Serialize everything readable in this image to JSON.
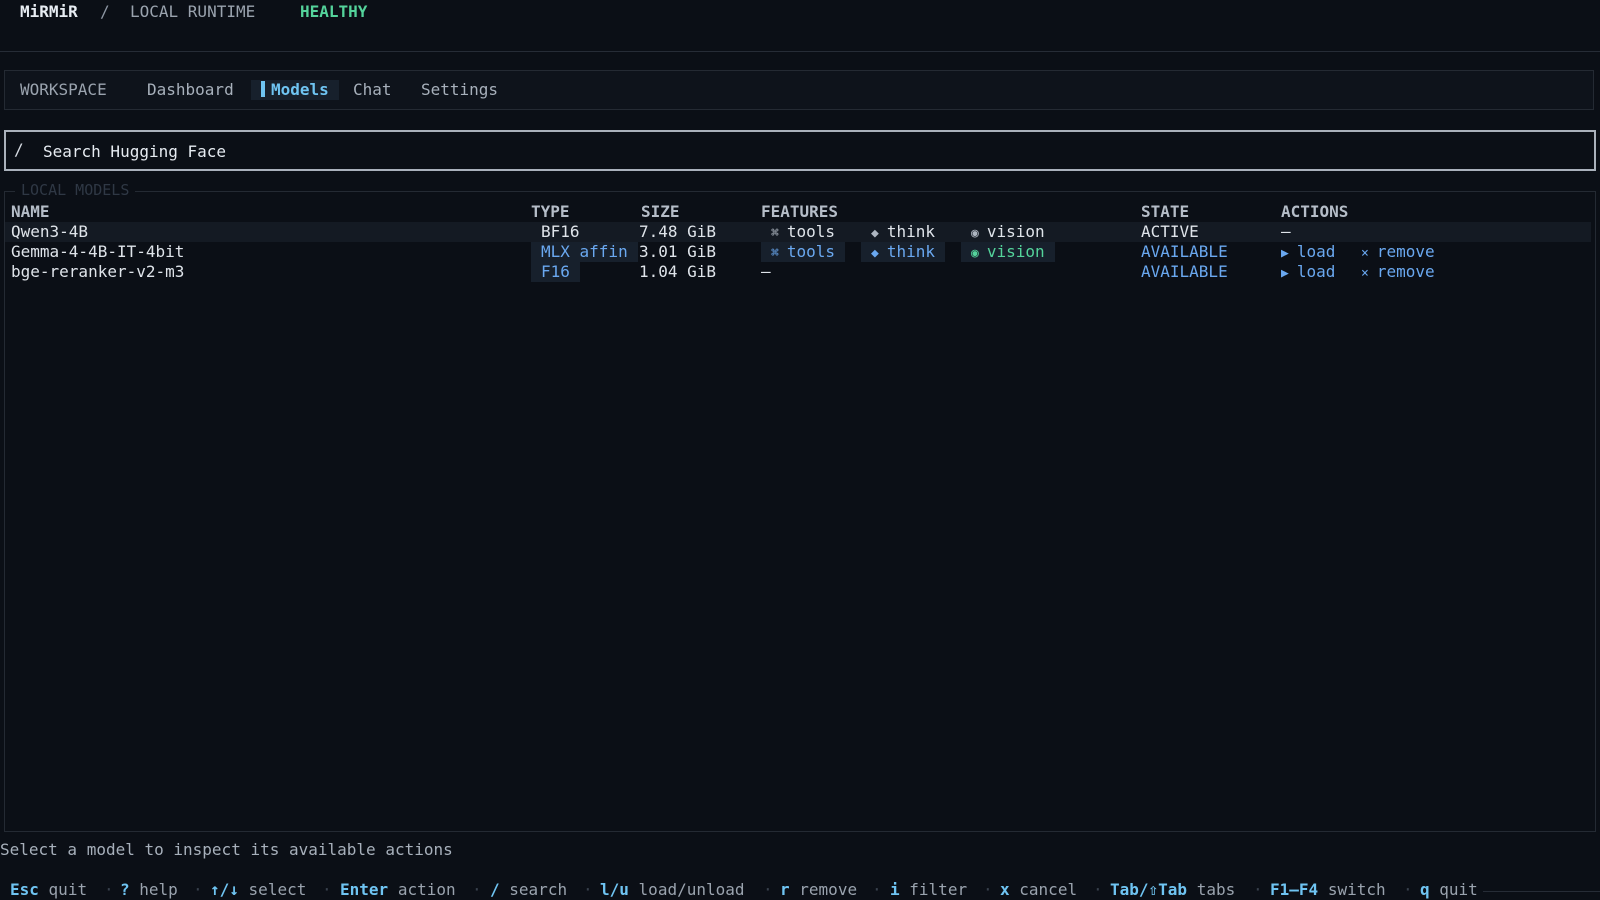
{
  "header": {
    "app_name": "MiRMiR",
    "separator": "/",
    "section": "LOCAL RUNTIME",
    "status": "HEALTHY"
  },
  "nav": {
    "workspace_label": "WORKSPACE",
    "tabs": [
      {
        "label": "Dashboard",
        "active": false
      },
      {
        "label": "Models",
        "active": true
      },
      {
        "label": "Chat",
        "active": false
      },
      {
        "label": "Settings",
        "active": false
      }
    ]
  },
  "search": {
    "prefix": "/",
    "placeholder": "Search Hugging Face"
  },
  "models_panel": {
    "title": "LOCAL MODELS",
    "columns": [
      "NAME",
      "TYPE",
      "SIZE",
      "FEATURES",
      "STATE",
      "ACTIONS"
    ],
    "rows": [
      {
        "name": "Qwen3-4B",
        "type": "BF16",
        "size": "7.48 GiB",
        "features": {
          "tools_glyph": "⌘",
          "tools": "tools",
          "think_glyph": "◆",
          "think": "think",
          "vision_glyph": "◉",
          "vision": "vision"
        },
        "state": "ACTIVE",
        "actions_placeholder": "—"
      },
      {
        "name": "Gemma-4-4B-IT-4bit",
        "type": "MLX affin",
        "size": "3.01 GiB",
        "features": {
          "tools_glyph": "⌘",
          "tools": "tools",
          "think_glyph": "◆",
          "think": "think",
          "vision_glyph": "◉",
          "vision": "vision"
        },
        "state": "AVAILABLE",
        "actions": {
          "load_glyph": "▶",
          "load": "load",
          "remove_glyph": "×",
          "remove": "remove"
        }
      },
      {
        "name": "bge-reranker-v2-m3",
        "type": "F16",
        "size": "1.04 GiB",
        "features_placeholder": "—",
        "state": "AVAILABLE",
        "actions": {
          "load_glyph": "▶",
          "load": "load",
          "remove_glyph": "×",
          "remove": "remove"
        }
      }
    ]
  },
  "status_line": "Select a model to inspect its available actions",
  "footer": {
    "separator": "·",
    "hints": [
      {
        "key": "Esc",
        "desc": "quit"
      },
      {
        "key": "?",
        "desc": "help"
      },
      {
        "key": "↑/↓",
        "desc": "select"
      },
      {
        "key": "Enter",
        "desc": "action"
      },
      {
        "key": "/",
        "desc": "search"
      },
      {
        "key": "l/u",
        "desc": "load/unload"
      },
      {
        "key": "r",
        "desc": "remove"
      },
      {
        "key": "i",
        "desc": "filter"
      },
      {
        "key": "x",
        "desc": "cancel"
      },
      {
        "key": "Tab/⇧Tab",
        "desc": "tabs"
      },
      {
        "key": "F1–F4",
        "desc": "switch"
      },
      {
        "key": "q",
        "desc": "quit"
      }
    ]
  },
  "colors": {
    "background": "#0b0f16",
    "accent_cyan": "#6fc4f2",
    "accent_blue": "#6aa8f0",
    "healthy_green": "#54d39b"
  }
}
